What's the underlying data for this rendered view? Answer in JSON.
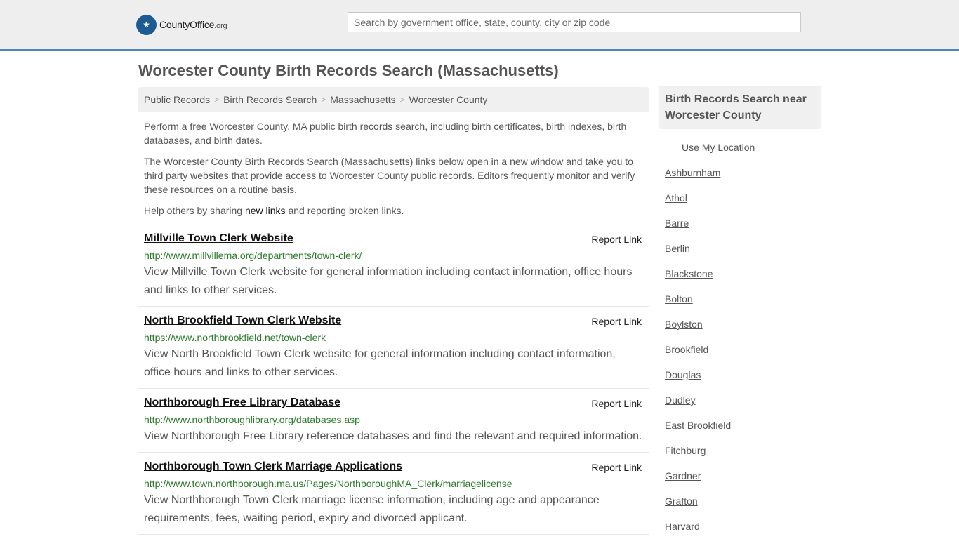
{
  "header": {
    "logo_icon": "eagle-stars-icon",
    "logo_county": "County",
    "logo_office": "Office",
    "logo_org": ".org",
    "search_placeholder": "Search by government office, state, county, city or zip code"
  },
  "page": {
    "title": "Worcester County Birth Records Search (Massachusetts)"
  },
  "breadcrumb": {
    "items": [
      "Public Records",
      "Birth Records Search",
      "Massachusetts",
      "Worcester County"
    ],
    "separator": ">"
  },
  "intro": {
    "p1": "Perform a free Worcester County, MA public birth records search, including birth certificates, birth indexes, birth databases, and birth dates.",
    "p2": "The Worcester County Birth Records Search (Massachusetts) links below open in a new window and take you to third party websites that provide access to Worcester County public records. Editors frequently monitor and verify these resources on a routine basis.",
    "p3_before": "Help others by sharing ",
    "p3_link": "new links",
    "p3_after": " and reporting broken links."
  },
  "results": [
    {
      "title": "Millville Town Clerk Website",
      "report": "Report Link",
      "url": "http://www.millvillema.org/departments/town-clerk/",
      "desc": "View Millville Town Clerk website for general information including contact information, office hours and links to other services."
    },
    {
      "title": "North Brookfield Town Clerk Website",
      "report": "Report Link",
      "url": "https://www.northbrookfield.net/town-clerk",
      "desc": "View North Brookfield Town Clerk website for general information including contact information, office hours and links to other services."
    },
    {
      "title": "Northborough Free Library Database",
      "report": "Report Link",
      "url": "http://www.northboroughlibrary.org/databases.asp",
      "desc": "View Northborough Free Library reference databases and find the relevant and required information."
    },
    {
      "title": "Northborough Town Clerk Marriage Applications",
      "report": "Report Link",
      "url": "http://www.town.northborough.ma.us/Pages/NorthboroughMA_Clerk/marriagelicense",
      "desc": "View Northborough Town Clerk marriage license information, including age and appearance requirements, fees, waiting period, expiry and divorced applicant."
    }
  ],
  "sidebar": {
    "heading": "Birth Records Search near Worcester County",
    "use_location": "Use My Location",
    "towns": [
      "Ashburnham",
      "Athol",
      "Barre",
      "Berlin",
      "Blackstone",
      "Bolton",
      "Boylston",
      "Brookfield",
      "Douglas",
      "Dudley",
      "East Brookfield",
      "Fitchburg",
      "Gardner",
      "Grafton",
      "Harvard"
    ]
  },
  "colors": {
    "header_bg": "#eeeeef",
    "header_border": "#4a84b5",
    "logo_badge": "#1f5b93",
    "url_green": "#2a7a2a"
  }
}
